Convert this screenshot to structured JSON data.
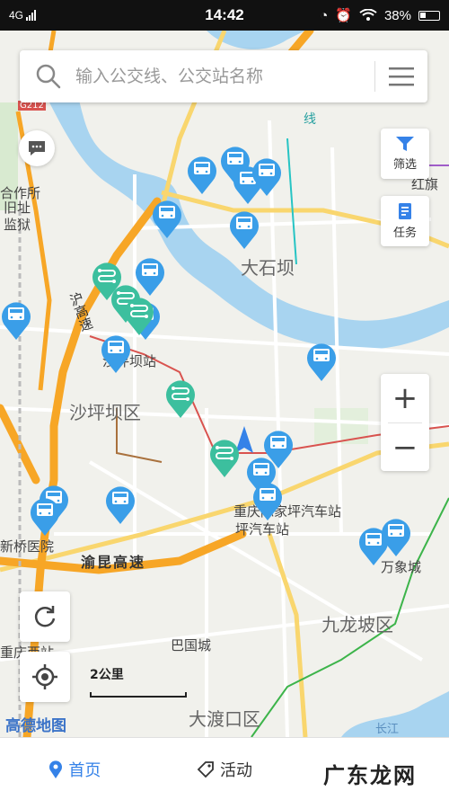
{
  "status_bar": {
    "network": "4G",
    "time": "14:42",
    "battery": "38%"
  },
  "search": {
    "placeholder": "输入公交线、公交站名称"
  },
  "side_buttons": {
    "filter_label": "筛选",
    "task_label": "任务"
  },
  "zoom": {
    "in_label": "+",
    "out_label": "−"
  },
  "map": {
    "labels": {
      "dashiba": "大石坝",
      "shapingba_district": "沙坪坝区",
      "shapingba_station": "沙坪坝站",
      "chongqing_caiyuanba": "重庆陈家坪汽车站",
      "chongqing_caiyuanba_line2": "坪汽车站",
      "xinqiao_hospital": "新桥医院",
      "yukun_expressway": "渝昆高速",
      "jiulongpo": "九龙坡区",
      "baguocheng": "巴国城",
      "dadukou": "大渡口区",
      "wanxiangcheng": "万象城",
      "hongqi": "红旗",
      "chongqing_west": "重庆西站",
      "hezuosuo": "合作所",
      "jiuzhi": "旧址",
      "jianyu": "监狱",
      "g212": "G212",
      "huhigh": "沪高速",
      "line_label": "线",
      "changjiang": "长江"
    },
    "scale_text": "2公里",
    "provider_logo": "高德地图"
  },
  "bottom_nav": {
    "home": "首页",
    "activity": "活动"
  },
  "watermark": "广东龙网",
  "colors": {
    "accent": "#3582e8",
    "bus_pin": "#3a9ee8",
    "green_pin": "#3cbf9e",
    "river": "#a8d4f0",
    "highway": "#f7a626"
  }
}
